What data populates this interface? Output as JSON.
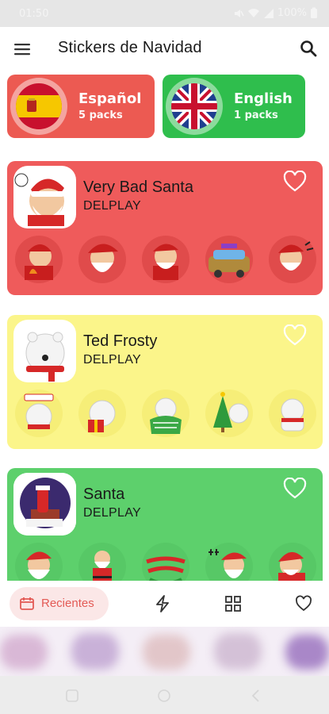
{
  "status_bar": {
    "time": "01:50",
    "battery": "100%"
  },
  "app_bar": {
    "title": "Stickers de Navidad"
  },
  "languages": [
    {
      "name": "Español",
      "count": "5 packs",
      "color": "#ec5a52",
      "flag": "spain-flag-icon"
    },
    {
      "name": "English",
      "count": "1 packs",
      "color": "#2fbe4d",
      "flag": "uk-flag-icon"
    }
  ],
  "packs": [
    {
      "name": "Very Bad Santa",
      "author": "DELPLAY",
      "color": "#ef5b5b"
    },
    {
      "name": "Ted Frosty",
      "author": "DELPLAY",
      "color": "#fbf58a"
    },
    {
      "name": "Santa",
      "author": "DELPLAY",
      "color": "#5dd06c"
    }
  ],
  "bottom_nav": {
    "recent_label": "Recientes",
    "items": [
      "history-icon",
      "bolt-icon",
      "grid-icon",
      "heart-outline-icon"
    ]
  }
}
